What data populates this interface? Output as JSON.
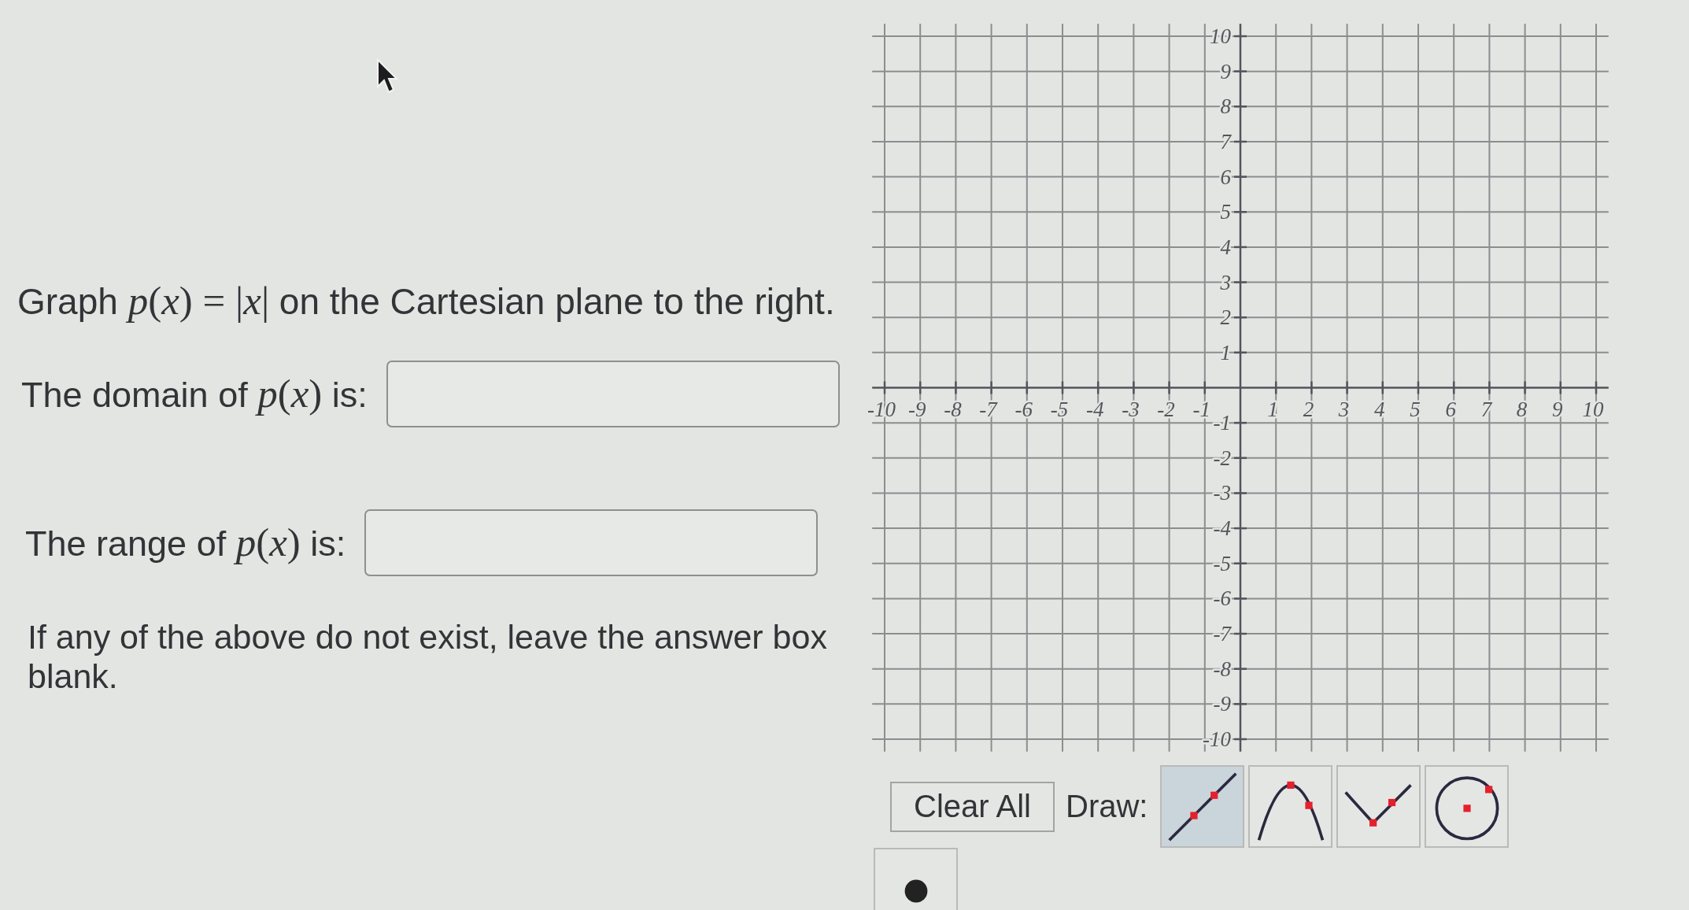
{
  "question": {
    "segments": [
      {
        "kind": "text",
        "text": "Graph "
      },
      {
        "kind": "math",
        "text": "*p*(*x*) = |*x*|"
      },
      {
        "kind": "text",
        "text": " on the Cartesian plane to the right."
      }
    ]
  },
  "answers": [
    {
      "label": [
        {
          "kind": "text",
          "text": "The domain of "
        },
        {
          "kind": "math",
          "text": "*p*(*x*)"
        },
        {
          "kind": "text",
          "text": " is:"
        }
      ]
    },
    {
      "label": [
        {
          "kind": "text",
          "text": "The range of "
        },
        {
          "kind": "math",
          "text": "*p*(*x*)"
        },
        {
          "kind": "text",
          "text": " is:"
        }
      ]
    }
  ],
  "note": "If any of the above do not exist, leave the answer box blank.",
  "graph": {
    "x_labels": [
      "-10",
      "-9",
      "-8",
      "-7",
      "-6",
      "-5",
      "-4",
      "-3",
      "-2",
      "-1",
      "1",
      "2",
      "3",
      "4",
      "5",
      "6",
      "7",
      "8",
      "9",
      "10"
    ],
    "y_labels": [
      "10",
      "9",
      "8",
      "7",
      "6",
      "5",
      "4",
      "3",
      "2",
      "1",
      "-1",
      "-2",
      "-3",
      "-4",
      "-5",
      "-6",
      "-7",
      "-8",
      "-9",
      "-10"
    ]
  },
  "toolbar": {
    "clear_button": "Clear All",
    "draw_label": "Draw:",
    "tools": [
      {
        "kind": "line",
        "selected": true
      },
      {
        "kind": "parabola",
        "selected": false
      },
      {
        "kind": "absolute-value",
        "selected": false
      },
      {
        "kind": "circle",
        "selected": false
      },
      {
        "kind": "point",
        "selected": false
      }
    ]
  }
}
